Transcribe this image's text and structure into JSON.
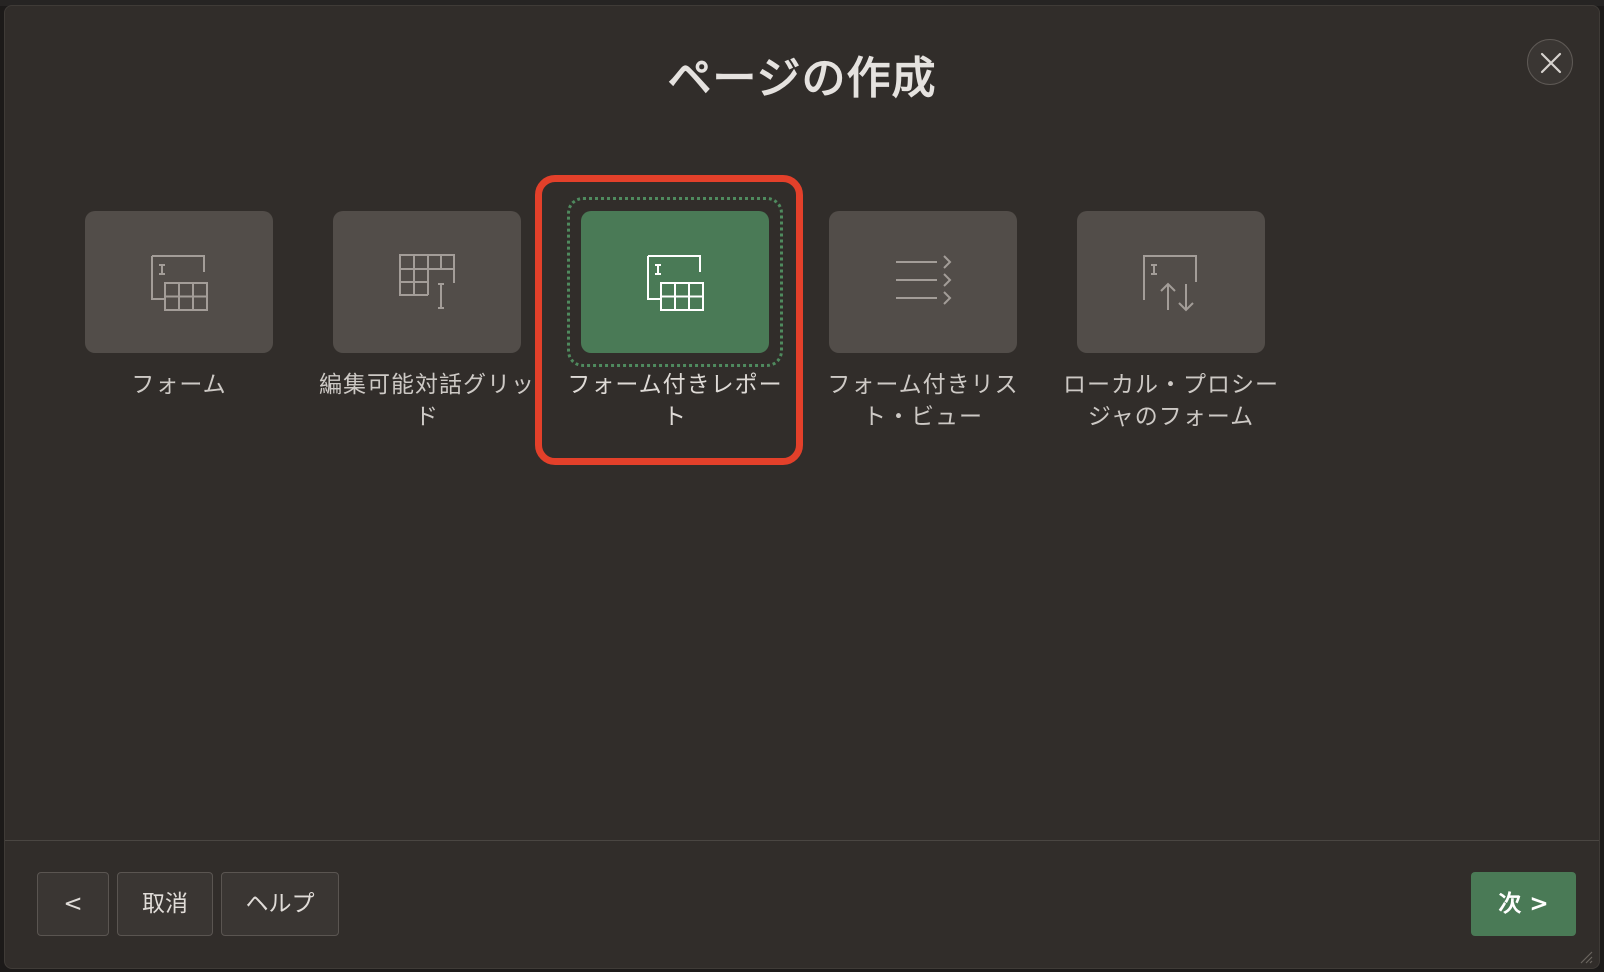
{
  "dialog": {
    "title": "ページの作成"
  },
  "tiles": [
    {
      "label": "フォーム",
      "icon": "form-icon"
    },
    {
      "label": "編集可能対話グリッド",
      "icon": "interactive-grid-icon"
    },
    {
      "label": "フォーム付きレポート",
      "icon": "report-with-form-icon",
      "selected": true
    },
    {
      "label": "フォーム付きリスト・ビュー",
      "icon": "list-view-icon"
    },
    {
      "label": "ローカル・プロシージャのフォーム",
      "icon": "procedure-form-icon"
    }
  ],
  "footer": {
    "back_label": "<",
    "cancel_label": "取消",
    "help_label": "ヘルプ",
    "next_label": "次 >"
  },
  "colors": {
    "dialog_bg": "#312d2a",
    "tile_bg": "#524d49",
    "selected_bg": "#4a7a56",
    "highlight": "#e3402a"
  }
}
